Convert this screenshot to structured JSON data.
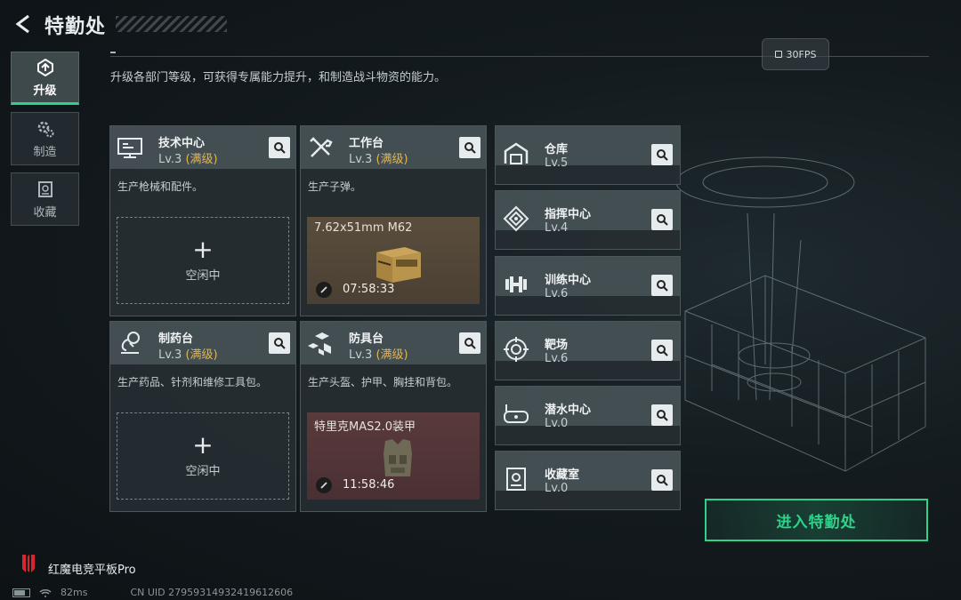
{
  "header": {
    "title": "特勤处",
    "description": "升级各部门等级，可获得专属能力提升，和制造战斗物资的能力。",
    "fps": "30FPS"
  },
  "nav": [
    {
      "label": "升级",
      "icon": "upgrade-icon",
      "active": true
    },
    {
      "label": "制造",
      "icon": "gears-icon",
      "active": false
    },
    {
      "label": "收藏",
      "icon": "collection-icon",
      "active": false
    }
  ],
  "workshops": [
    {
      "name": "技术中心",
      "level": "Lv.3",
      "max_tag": "(满级)",
      "desc": "生产枪械和配件。",
      "icon": "monitor-icon",
      "slot": {
        "status": "空闲中"
      }
    },
    {
      "name": "工作台",
      "level": "Lv.3",
      "max_tag": "(满级)",
      "desc": "生产子弹。",
      "icon": "tools-icon",
      "slot": {
        "item": "7.62x51mm M62",
        "timer": "07:58:33",
        "image": "ammo-box-icon"
      }
    },
    {
      "name": "制药台",
      "level": "Lv.3",
      "max_tag": "(满级)",
      "desc": "生产药品、针剂和维修工具包。",
      "icon": "microscope-icon",
      "slot": {
        "status": "空闲中"
      }
    },
    {
      "name": "防具台",
      "level": "Lv.3",
      "max_tag": "(满级)",
      "desc": "生产头盔、护甲、胸挂和背包。",
      "icon": "cubes-icon",
      "slot": {
        "item": "特里克MAS2.0装甲",
        "timer": "11:58:46",
        "image": "armor-vest-icon"
      }
    }
  ],
  "facilities": [
    {
      "name": "仓库",
      "level": "Lv.5",
      "icon": "warehouse-icon"
    },
    {
      "name": "指挥中心",
      "level": "Lv.4",
      "icon": "command-icon"
    },
    {
      "name": "训练中心",
      "level": "Lv.6",
      "icon": "dumbbell-icon"
    },
    {
      "name": "靶场",
      "level": "Lv.6",
      "icon": "target-icon"
    },
    {
      "name": "潜水中心",
      "level": "Lv.0",
      "icon": "diving-mask-icon"
    },
    {
      "name": "收藏室",
      "level": "Lv.0",
      "icon": "collection-room-icon"
    }
  ],
  "enter_button": "进入特勤处",
  "footer": {
    "brand": "红魔电竞平板Pro",
    "ping": "82ms",
    "uid": "CN UID 27959314932419612606"
  },
  "colors": {
    "accent": "#2fd28b",
    "maxed": "#e5b54b"
  }
}
